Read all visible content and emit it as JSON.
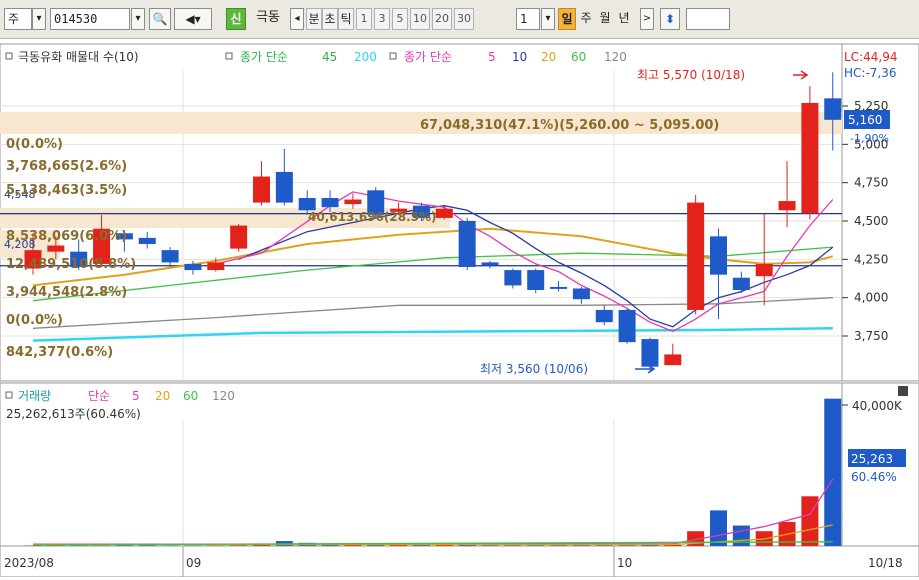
{
  "toolbar": {
    "market": "주",
    "code": "014530",
    "new_badge": "신",
    "name": "극동",
    "periods": [
      "분",
      "초",
      "틱",
      "1",
      "3",
      "5",
      "10",
      "20",
      "30"
    ],
    "interval": "1",
    "units": [
      "일",
      "주",
      "월",
      "년"
    ]
  },
  "colors": {
    "up": "#e3231b",
    "down": "#1f5bc8",
    "ma5": "#e838b4",
    "ma10": "#2a3aa8",
    "ma20": "#e0a21b",
    "ma60": "#3fc23f",
    "ma120": "#888888",
    "ma45": "#2fd6f0"
  },
  "legend_price": {
    "main": "극동유화 매물대 수(10)",
    "g1_label": "종가 단순",
    "g1_values": [
      "45",
      "200"
    ],
    "g2_label": "종가 단순",
    "g2_values": [
      "5",
      "10",
      "20",
      "60",
      "120"
    ]
  },
  "right_info": {
    "lc": "LC:44,94",
    "hc": "HC:-7,36",
    "last_price": "5,160",
    "last_change": "-1,90%"
  },
  "annotations": {
    "high_text": "최고 5,570 (10/18)",
    "low_text": "최저 3,560 (10/06)",
    "top_volume_bin": "67,048,310(47.1%)(5,260.00 ~ 5,095.00)",
    "mid_volume_bin": "40,613,696(28.5%)",
    "left_label": "4,548",
    "left_label2": "4,208"
  },
  "volume_profile": [
    "0(0.0%)",
    "3,768,665(2.6%)",
    "5,138,463(3.5%)",
    "8,538,069(6.0%)",
    "12,489,510(8.8%)",
    "3,944,548(2.8%)",
    "0(0.0%)",
    "842,377(0.6%)"
  ],
  "legend_volume": {
    "main": "거래량",
    "sub": "단순",
    "periods": [
      "5",
      "20",
      "60",
      "120"
    ],
    "info": "25,262,613주(60.46%)"
  },
  "volume_axis": {
    "tick": "40,000K",
    "last": "25,263",
    "pct": "60.46%"
  },
  "x_labels": [
    "2023/08",
    "09",
    "10",
    "10/18"
  ],
  "chart_data": {
    "type": "candlestick",
    "price_axis": {
      "ticks": [
        3750,
        4000,
        4250,
        4500,
        4750,
        5000,
        5250
      ],
      "tick_labels": [
        "3,750",
        "4,000",
        "4,250",
        "4,500",
        "4,750",
        "5,000",
        "5,250"
      ]
    },
    "horizontal_lines": [
      4548,
      4208
    ],
    "candles": [
      {
        "o": 4190,
        "c": 4310,
        "h": 4420,
        "l": 4150
      },
      {
        "o": 4300,
        "c": 4340,
        "h": 4400,
        "l": 4250
      },
      {
        "o": 4300,
        "c": 4200,
        "h": 4380,
        "l": 4180
      },
      {
        "o": 4220,
        "c": 4450,
        "h": 4540,
        "l": 4200
      },
      {
        "o": 4420,
        "c": 4380,
        "h": 4440,
        "l": 4300
      },
      {
        "o": 4390,
        "c": 4350,
        "h": 4430,
        "l": 4320
      },
      {
        "o": 4310,
        "c": 4230,
        "h": 4330,
        "l": 4200
      },
      {
        "o": 4220,
        "c": 4180,
        "h": 4240,
        "l": 4150
      },
      {
        "o": 4180,
        "c": 4230,
        "h": 4260,
        "l": 4170
      },
      {
        "o": 4320,
        "c": 4470,
        "h": 4480,
        "l": 4300
      },
      {
        "o": 4620,
        "c": 4790,
        "h": 4890,
        "l": 4600
      },
      {
        "o": 4820,
        "c": 4620,
        "h": 4970,
        "l": 4600
      },
      {
        "o": 4650,
        "c": 4570,
        "h": 4700,
        "l": 4540
      },
      {
        "o": 4650,
        "c": 4590,
        "h": 4700,
        "l": 4560
      },
      {
        "o": 4610,
        "c": 4640,
        "h": 4680,
        "l": 4580
      },
      {
        "o": 4700,
        "c": 4540,
        "h": 4720,
        "l": 4520
      },
      {
        "o": 4560,
        "c": 4580,
        "h": 4620,
        "l": 4540
      },
      {
        "o": 4600,
        "c": 4520,
        "h": 4620,
        "l": 4500
      },
      {
        "o": 4520,
        "c": 4580,
        "h": 4600,
        "l": 4510
      },
      {
        "o": 4500,
        "c": 4200,
        "h": 4520,
        "l": 4180
      },
      {
        "o": 4230,
        "c": 4210,
        "h": 4240,
        "l": 4190
      },
      {
        "o": 4180,
        "c": 4080,
        "h": 4190,
        "l": 4060
      },
      {
        "o": 4180,
        "c": 4050,
        "h": 4190,
        "l": 4030
      },
      {
        "o": 4070,
        "c": 4060,
        "h": 4110,
        "l": 4040
      },
      {
        "o": 4060,
        "c": 3990,
        "h": 4070,
        "l": 3960
      },
      {
        "o": 3920,
        "c": 3840,
        "h": 3950,
        "l": 3820
      },
      {
        "o": 3920,
        "c": 3710,
        "h": 3930,
        "l": 3700
      },
      {
        "o": 3730,
        "c": 3550,
        "h": 3740,
        "l": 3520
      },
      {
        "o": 3560,
        "c": 3630,
        "h": 3700,
        "l": 3560
      },
      {
        "o": 3920,
        "c": 4620,
        "h": 4670,
        "l": 3890
      },
      {
        "o": 4400,
        "c": 4150,
        "h": 4450,
        "l": 3860
      },
      {
        "o": 4130,
        "c": 4050,
        "h": 4170,
        "l": 4030
      },
      {
        "o": 4140,
        "c": 4220,
        "h": 4550,
        "l": 3950
      },
      {
        "o": 4570,
        "c": 4630,
        "h": 4890,
        "l": 4460
      },
      {
        "o": 4550,
        "c": 5270,
        "h": 5380,
        "l": 4510
      },
      {
        "o": 5300,
        "c": 5160,
        "h": 5470,
        "l": 4960
      }
    ],
    "volume": [
      0.1,
      0.1,
      0.1,
      0.1,
      0.2,
      0.2,
      0.1,
      0.1,
      0.1,
      0.2,
      0.3,
      1.4,
      0.9,
      0.5,
      0.4,
      0.6,
      0.4,
      0.3,
      0.3,
      0.4,
      0.2,
      0.2,
      0.2,
      0.2,
      0.2,
      0.2,
      0.2,
      0.3,
      0.3,
      4.2,
      10.1,
      5.8,
      4.2,
      6.8,
      14.1,
      41.8,
      25.3
    ],
    "ma5": [
      [
        8,
        4220
      ],
      [
        10,
        4290
      ],
      [
        13,
        4600
      ],
      [
        14,
        4690
      ],
      [
        15,
        4660
      ],
      [
        16,
        4630
      ],
      [
        18,
        4590
      ],
      [
        19,
        4480
      ],
      [
        20,
        4400
      ],
      [
        21,
        4300
      ],
      [
        22,
        4220
      ],
      [
        23,
        4170
      ],
      [
        24,
        4080
      ],
      [
        25,
        4010
      ],
      [
        26,
        3930
      ],
      [
        27,
        3840
      ],
      [
        28,
        3780
      ],
      [
        29,
        3860
      ],
      [
        30,
        3960
      ],
      [
        31,
        4000
      ],
      [
        32,
        4040
      ],
      [
        33,
        4270
      ],
      [
        34,
        4470
      ],
      [
        35,
        4640
      ]
    ],
    "ma10": [
      [
        9,
        4250
      ],
      [
        12,
        4430
      ],
      [
        15,
        4520
      ],
      [
        17,
        4580
      ],
      [
        18,
        4600
      ],
      [
        19,
        4570
      ],
      [
        20,
        4490
      ],
      [
        21,
        4420
      ],
      [
        22,
        4320
      ],
      [
        23,
        4230
      ],
      [
        24,
        4160
      ],
      [
        25,
        4080
      ],
      [
        26,
        3980
      ],
      [
        27,
        3860
      ],
      [
        28,
        3810
      ],
      [
        29,
        3920
      ],
      [
        30,
        4000
      ],
      [
        31,
        4040
      ],
      [
        32,
        4100
      ],
      [
        33,
        4150
      ],
      [
        34,
        4210
      ],
      [
        35,
        4330
      ]
    ],
    "ma20": [
      [
        0,
        4080
      ],
      [
        4,
        4150
      ],
      [
        8,
        4240
      ],
      [
        12,
        4350
      ],
      [
        16,
        4410
      ],
      [
        20,
        4450
      ],
      [
        24,
        4400
      ],
      [
        28,
        4290
      ],
      [
        30,
        4250
      ],
      [
        32,
        4220
      ],
      [
        34,
        4230
      ],
      [
        35,
        4270
      ]
    ],
    "ma60": [
      [
        0,
        3980
      ],
      [
        6,
        4080
      ],
      [
        12,
        4180
      ],
      [
        18,
        4260
      ],
      [
        24,
        4290
      ],
      [
        30,
        4270
      ],
      [
        35,
        4330
      ]
    ],
    "ma120": [
      [
        0,
        3800
      ],
      [
        8,
        3870
      ],
      [
        16,
        3950
      ],
      [
        24,
        3950
      ],
      [
        30,
        3960
      ],
      [
        35,
        4000
      ]
    ],
    "ma45": [
      [
        0,
        3720
      ],
      [
        10,
        3770
      ],
      [
        20,
        3780
      ],
      [
        30,
        3790
      ],
      [
        35,
        3800
      ]
    ]
  }
}
